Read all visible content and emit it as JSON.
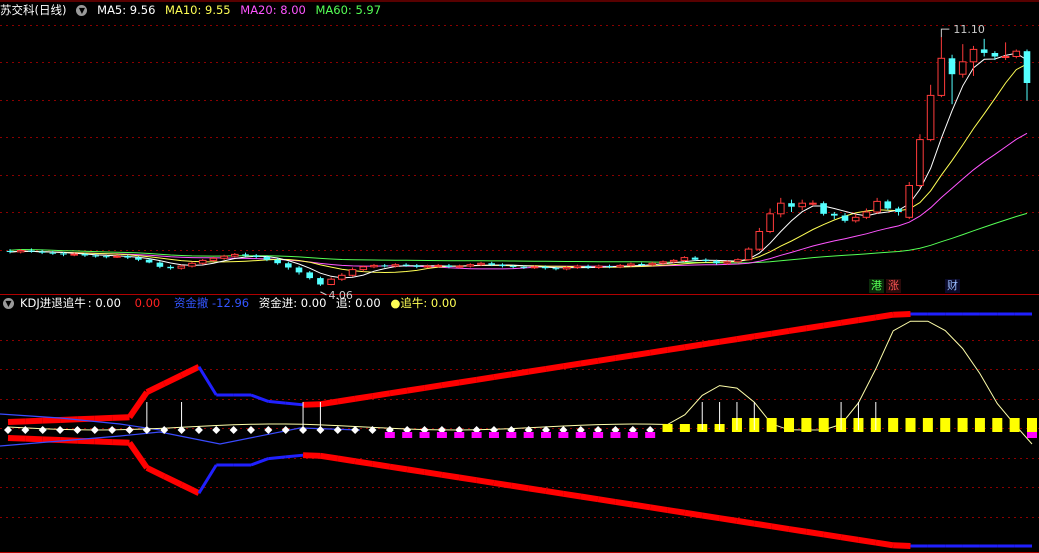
{
  "top_legend": {
    "stock": "苏交科",
    "period": "(日线)",
    "ma5": {
      "label": "MA5:",
      "value": "9.56",
      "color": "#ffffff"
    },
    "ma10": {
      "label": "MA10:",
      "value": "9.55",
      "color": "#ffff55"
    },
    "ma20": {
      "label": "MA20:",
      "value": "8.00",
      "color": "#ff55ff"
    },
    "ma60": {
      "label": "MA60:",
      "value": "5.97",
      "color": "#55ff55"
    }
  },
  "bottom_legend": {
    "indicator": "KDJ进退追牛",
    "v1": ": 0.00",
    "v2": "0.00",
    "zijin_cut": {
      "label": "资金撤",
      "value": "-12.96"
    },
    "zijin_in": {
      "label": "资金进:",
      "value": "0.00"
    },
    "zhui": {
      "label": "追:",
      "value": "0.00"
    },
    "zhuiniu": {
      "label": "追牛:",
      "value": "0.00"
    }
  },
  "annotations": {
    "high_price": "11.10",
    "low_price": "4.06",
    "tag_gang": "港",
    "tag_zhang": "涨",
    "tag_cai": "财"
  },
  "colors": {
    "up": "#ff3b3b",
    "down": "#54ffff",
    "ma5": "#ffffff",
    "ma10": "#ffff55",
    "ma20": "#ff55ff",
    "ma60": "#55ff55",
    "grid": "#8b0000",
    "ribbon_up": "#ff0000",
    "ribbon_down": "#2020ff",
    "bar_yellow": "#ffff00",
    "bar_magenta": "#ff00ff"
  },
  "chart_data": {
    "type": "candlestick",
    "price_range": [
      4.0,
      11.3
    ],
    "candles": [
      [
        5.05,
        5.02,
        5.1,
        4.98
      ],
      [
        5.02,
        5.06,
        5.1,
        4.98
      ],
      [
        5.06,
        5.03,
        5.12,
        5.0
      ],
      [
        5.03,
        5.0,
        5.08,
        4.96
      ],
      [
        5.0,
        4.98,
        5.05,
        4.94
      ],
      [
        4.98,
        4.95,
        5.02,
        4.9
      ],
      [
        4.95,
        4.96,
        5.0,
        4.9
      ],
      [
        4.96,
        4.92,
        5.0,
        4.88
      ],
      [
        4.92,
        4.9,
        4.96,
        4.86
      ],
      [
        4.9,
        4.88,
        4.94,
        4.84
      ],
      [
        4.88,
        4.9,
        4.95,
        4.85
      ],
      [
        4.9,
        4.86,
        4.94,
        4.82
      ],
      [
        4.86,
        4.8,
        4.9,
        4.76
      ],
      [
        4.8,
        4.72,
        4.84,
        4.7
      ],
      [
        4.72,
        4.6,
        4.76,
        4.56
      ],
      [
        4.6,
        4.56,
        4.65,
        4.52
      ],
      [
        4.56,
        4.62,
        4.66,
        4.52
      ],
      [
        4.62,
        4.7,
        4.74,
        4.58
      ],
      [
        4.7,
        4.78,
        4.82,
        4.66
      ],
      [
        4.78,
        4.84,
        4.88,
        4.74
      ],
      [
        4.84,
        4.9,
        4.94,
        4.8
      ],
      [
        4.9,
        4.95,
        4.99,
        4.86
      ],
      [
        4.95,
        4.92,
        5.0,
        4.88
      ],
      [
        4.92,
        4.88,
        4.96,
        4.84
      ],
      [
        4.88,
        4.8,
        4.92,
        4.76
      ],
      [
        4.8,
        4.7,
        4.84,
        4.66
      ],
      [
        4.7,
        4.58,
        4.74,
        4.52
      ],
      [
        4.58,
        4.44,
        4.62,
        4.38
      ],
      [
        4.44,
        4.28,
        4.48,
        4.24
      ],
      [
        4.28,
        4.1,
        4.32,
        4.06
      ],
      [
        4.1,
        4.25,
        4.3,
        4.08
      ],
      [
        4.25,
        4.36,
        4.42,
        4.2
      ],
      [
        4.36,
        4.52,
        4.58,
        4.32
      ],
      [
        4.52,
        4.6,
        4.64,
        4.46
      ],
      [
        4.6,
        4.64,
        4.68,
        4.56
      ],
      [
        4.64,
        4.62,
        4.68,
        4.58
      ],
      [
        4.62,
        4.66,
        4.7,
        4.58
      ],
      [
        4.66,
        4.64,
        4.7,
        4.6
      ],
      [
        4.64,
        4.6,
        4.68,
        4.56
      ],
      [
        4.6,
        4.62,
        4.66,
        4.56
      ],
      [
        4.62,
        4.64,
        4.68,
        4.58
      ],
      [
        4.64,
        4.6,
        4.68,
        4.56
      ],
      [
        4.6,
        4.62,
        4.66,
        4.56
      ],
      [
        4.62,
        4.66,
        4.7,
        4.58
      ],
      [
        4.66,
        4.7,
        4.74,
        4.62
      ],
      [
        4.7,
        4.66,
        4.74,
        4.62
      ],
      [
        4.66,
        4.62,
        4.7,
        4.58
      ],
      [
        4.62,
        4.6,
        4.66,
        4.56
      ],
      [
        4.6,
        4.58,
        4.64,
        4.54
      ],
      [
        4.58,
        4.6,
        4.64,
        4.54
      ],
      [
        4.6,
        4.56,
        4.64,
        4.52
      ],
      [
        4.56,
        4.54,
        4.6,
        4.5
      ],
      [
        4.54,
        4.58,
        4.62,
        4.5
      ],
      [
        4.58,
        4.62,
        4.66,
        4.54
      ],
      [
        4.62,
        4.58,
        4.66,
        4.54
      ],
      [
        4.58,
        4.62,
        4.66,
        4.54
      ],
      [
        4.62,
        4.6,
        4.66,
        4.56
      ],
      [
        4.6,
        4.64,
        4.68,
        4.56
      ],
      [
        4.64,
        4.68,
        4.72,
        4.6
      ],
      [
        4.68,
        4.66,
        4.72,
        4.62
      ],
      [
        4.66,
        4.7,
        4.74,
        4.62
      ],
      [
        4.7,
        4.74,
        4.78,
        4.66
      ],
      [
        4.74,
        4.78,
        4.82,
        4.7
      ],
      [
        4.78,
        4.86,
        4.9,
        4.74
      ],
      [
        4.86,
        4.8,
        4.9,
        4.76
      ],
      [
        4.8,
        4.76,
        4.84,
        4.72
      ],
      [
        4.76,
        4.7,
        4.8,
        4.66
      ],
      [
        4.7,
        4.74,
        4.78,
        4.66
      ],
      [
        4.74,
        4.8,
        4.84,
        4.7
      ],
      [
        4.8,
        5.1,
        5.15,
        4.78
      ],
      [
        5.1,
        5.6,
        5.7,
        5.05
      ],
      [
        5.6,
        6.1,
        6.25,
        5.55
      ],
      [
        6.1,
        6.4,
        6.55,
        6.0
      ],
      [
        6.4,
        6.3,
        6.5,
        6.15
      ],
      [
        6.3,
        6.4,
        6.5,
        6.2
      ],
      [
        6.4,
        6.4,
        6.48,
        6.32
      ],
      [
        6.4,
        6.1,
        6.45,
        6.05
      ],
      [
        6.1,
        6.05,
        6.15,
        5.95
      ],
      [
        6.05,
        5.9,
        6.12,
        5.85
      ],
      [
        5.9,
        6.0,
        6.1,
        5.85
      ],
      [
        6.0,
        6.15,
        6.25,
        5.95
      ],
      [
        6.15,
        6.45,
        6.55,
        6.1
      ],
      [
        6.45,
        6.25,
        6.5,
        6.2
      ],
      [
        6.25,
        6.15,
        6.3,
        6.05
      ],
      [
        6.0,
        6.9,
        7.0,
        5.95
      ],
      [
        6.9,
        8.2,
        8.35,
        6.85
      ],
      [
        8.2,
        9.45,
        9.75,
        8.15
      ],
      [
        9.45,
        10.5,
        11.1,
        9.4
      ],
      [
        10.5,
        10.05,
        10.6,
        9.2
      ],
      [
        10.05,
        10.4,
        10.9,
        9.95
      ],
      [
        10.4,
        10.75,
        10.85,
        10.0
      ],
      [
        10.75,
        10.65,
        11.05,
        10.55
      ],
      [
        10.65,
        10.55,
        10.7,
        10.45
      ],
      [
        10.55,
        10.55,
        10.95,
        10.45
      ],
      [
        10.55,
        10.7,
        10.75,
        10.5
      ],
      [
        10.7,
        9.8,
        10.75,
        9.3
      ]
    ]
  }
}
